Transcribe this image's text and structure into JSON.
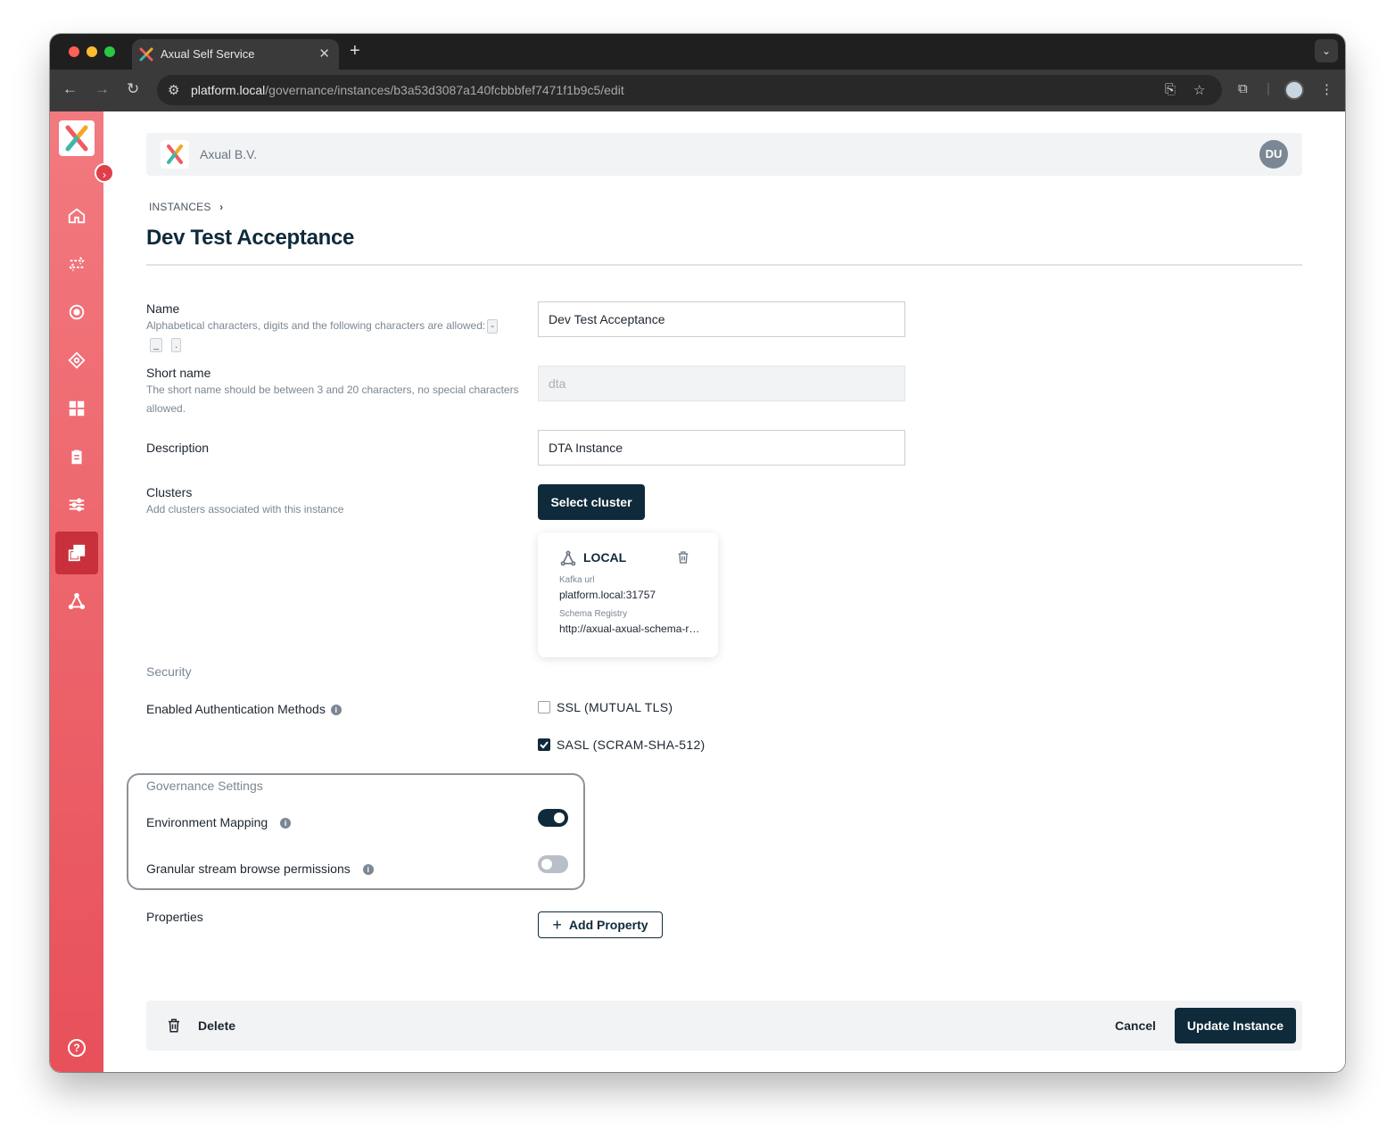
{
  "browser": {
    "tab_title": "Axual Self Service",
    "tab_close": "✕",
    "new_tab": "+",
    "tab_menu": "⌄",
    "url_host": "platform.local",
    "url_path": "/governance/instances/b3a53d3087a140fcbbbfef7471f1b9c5/edit"
  },
  "header": {
    "org_name": "Axual B.V.",
    "avatar_initials": "DU"
  },
  "sidebar": {
    "toggle": "›",
    "items": [
      {
        "name": "home-icon"
      },
      {
        "name": "transfer-icon"
      },
      {
        "name": "target-icon"
      },
      {
        "name": "diamond-icon"
      },
      {
        "name": "grid-icon"
      },
      {
        "name": "clipboard-icon"
      },
      {
        "name": "sliders-icon"
      },
      {
        "name": "instances-icon",
        "active": true
      },
      {
        "name": "cluster-icon"
      }
    ],
    "help": "?"
  },
  "page": {
    "breadcrumb": "INSTANCES",
    "breadcrumb_sep": "›",
    "title": "Dev Test Acceptance"
  },
  "form": {
    "name": {
      "label": "Name",
      "help": "Alphabetical characters, digits and the following characters are allowed:",
      "chars": [
        "-",
        "_",
        "."
      ],
      "value": "Dev Test Acceptance"
    },
    "short_name": {
      "label": "Short name",
      "help_line1": "The short name should be between 3 and 20 characters, no special characters",
      "help_line2": "allowed.",
      "value": "dta"
    },
    "description": {
      "label": "Description",
      "value": "DTA Instance"
    },
    "clusters": {
      "label": "Clusters",
      "help": "Add clusters associated with this instance",
      "select_button": "Select cluster",
      "card": {
        "name": "LOCAL",
        "kafka_label": "Kafka url",
        "kafka_value": "platform.local:31757",
        "schema_label": "Schema Registry",
        "schema_value": "http://axual-axual-schema-registry"
      }
    },
    "security": {
      "section": "Security",
      "auth_label": "Enabled Authentication Methods",
      "methods": [
        {
          "label": "SSL (MUTUAL TLS)",
          "checked": false
        },
        {
          "label": "SASL (SCRAM-SHA-512)",
          "checked": true
        }
      ]
    },
    "governance": {
      "section": "Governance Settings",
      "env_mapping_label": "Environment Mapping",
      "env_mapping_on": true,
      "granular_label": "Granular stream browse permissions",
      "granular_on": false
    },
    "properties": {
      "label": "Properties",
      "add_button": "Add Property"
    }
  },
  "footer": {
    "delete": "Delete",
    "cancel": "Cancel",
    "update": "Update Instance"
  },
  "colors": {
    "primary": "#0f2a3a",
    "sidebar_top": "#f27a7f",
    "sidebar_bottom": "#e8505a",
    "toggle_off": "#b8bfc6"
  }
}
